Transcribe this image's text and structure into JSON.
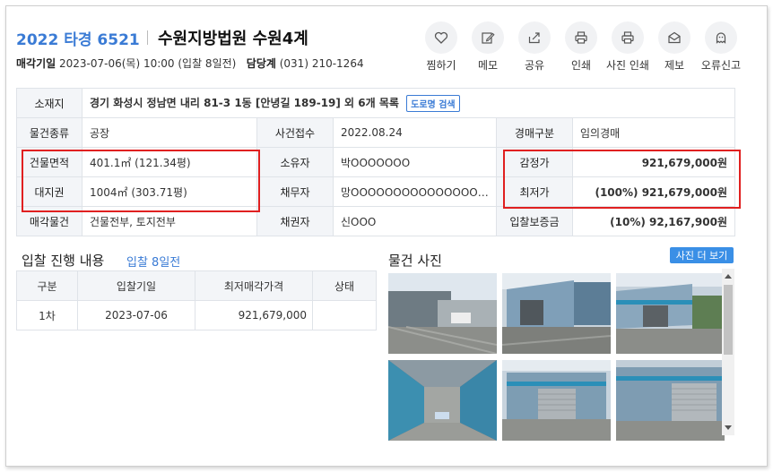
{
  "header": {
    "case_number": "2022 타경 6521",
    "court": "수원지방법원 수원4계",
    "sale_date_label": "매각기일",
    "sale_date_value": "2023-07-06(목) 10:00 (입찰 8일전)",
    "dept_label": "담당계",
    "dept_value": "(031) 210-1264"
  },
  "actions": [
    {
      "label": "찜하기",
      "icon": "heart-icon"
    },
    {
      "label": "메모",
      "icon": "pencil-icon"
    },
    {
      "label": "공유",
      "icon": "share-icon"
    },
    {
      "label": "인쇄",
      "icon": "printer-icon"
    },
    {
      "label": "사진 인쇄",
      "icon": "printer-icon"
    },
    {
      "label": "제보",
      "icon": "mail-icon"
    },
    {
      "label": "오류신고",
      "icon": "ghost-icon"
    }
  ],
  "info": {
    "location_label": "소재지",
    "location_value": "경기 화성시 정남면 내리 81-3 1동 [안녕길 189-19] 외 6개 목록",
    "road_search": "도로명 검색",
    "type_label": "물건종류",
    "type_value": "공장",
    "received_label": "사건접수",
    "received_value": "2022.08.24",
    "auction_kind_label": "경매구분",
    "auction_kind_value": "임의경매",
    "building_area_label": "건물면적",
    "building_area_value": "401.1㎡ (121.34평)",
    "owner_label": "소유자",
    "owner_value": "박OOOOOOO",
    "appraisal_label": "감정가",
    "appraisal_value": "921,679,000원",
    "land_right_label": "대지권",
    "land_right_value": "1004㎡ (303.71평)",
    "debtor_label": "채무자",
    "debtor_value": "망OOOOOOOOOOOOOOOOOOO",
    "min_price_label": "최저가",
    "min_price_value": "(100%) 921,679,000원",
    "sale_item_label": "매각물건",
    "sale_item_value": "건물전부, 토지전부",
    "creditor_label": "채권자",
    "creditor_value": "신OOO",
    "deposit_label": "입찰보증금",
    "deposit_value": "(10%) 92,167,900원"
  },
  "bidding": {
    "title": "입찰 진행 내용",
    "subtitle": "입찰 8일전",
    "columns": [
      "구분",
      "입찰기일",
      "최저매각가격",
      "상태"
    ],
    "rows": [
      {
        "round": "1차",
        "date": "2023-07-06",
        "price": "921,679,000",
        "status": ""
      }
    ]
  },
  "photos": {
    "title": "물건 사진",
    "more_button": "사진 더 보기"
  },
  "colors": {
    "accent": "#3a7bd5",
    "highlight": "#e02020",
    "label_bg": "#f3f5f8"
  }
}
